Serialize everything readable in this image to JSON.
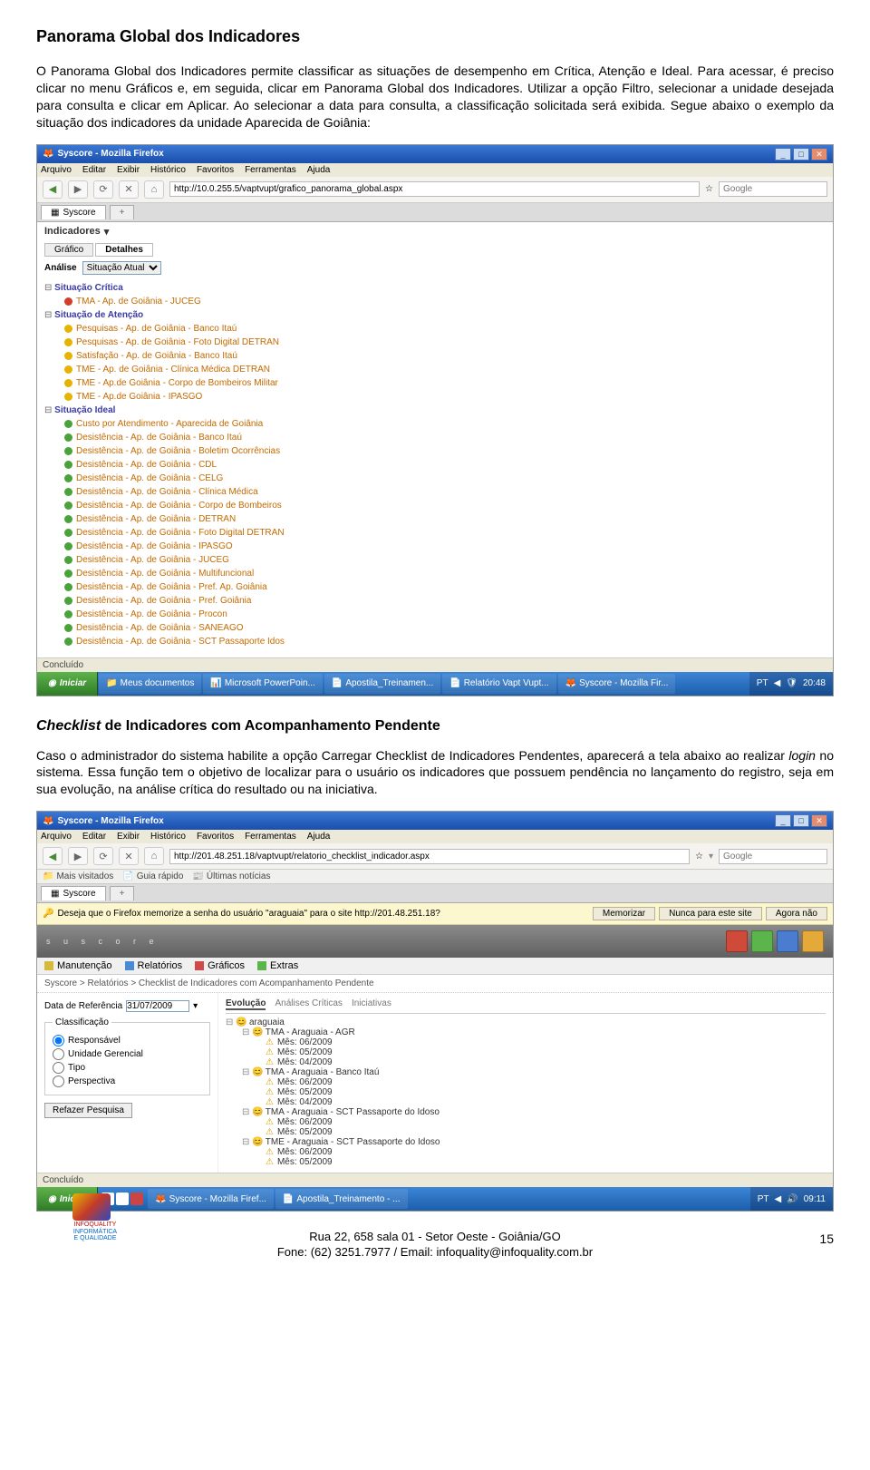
{
  "h1": "Panorama Global dos Indicadores",
  "p1a": "O Panorama Global dos Indicadores permite classificar as situações de desempenho em Crítica, Atenção e Ideal. Para acessar, é preciso clicar no menu Gráficos e, em seguida, clicar em Panorama Global dos Indicadores. Utilizar a opção Filtro, selecionar a unidade desejada para consulta e clicar em Aplicar. Ao selecionar a data para consulta, a classificação solicitada será exibida. Segue abaixo o exemplo da situação dos indicadores da unidade Aparecida de Goiânia:",
  "h2_prefix": "Checklist",
  "h2_rest": " de Indicadores com Acompanhamento Pendente",
  "p2": "Caso o administrador do sistema habilite a opção Carregar Checklist de Indicadores Pendentes, aparecerá a tela abaixo ao realizar ",
  "p2_italic": "login",
  "p2_end": " no sistema. Essa função tem o objetivo de localizar para o usuário os indicadores que possuem pendência no lançamento do registro, seja em sua evolução, na análise crítica do resultado ou na iniciativa.",
  "ss1": {
    "title": "Syscore - Mozilla Firefox",
    "menu": [
      "Arquivo",
      "Editar",
      "Exibir",
      "Histórico",
      "Favoritos",
      "Ferramentas",
      "Ajuda"
    ],
    "url": "http://10.0.255.5/vaptvupt/grafico_panorama_global.aspx",
    "search_ph": "Google",
    "tab": "Syscore",
    "content_title": "Indicadores",
    "subtabs": [
      "Gráfico",
      "Detalhes"
    ],
    "analysis_label": "Análise",
    "analysis_sel": "Situação Atual",
    "groups": [
      {
        "name": "Situação Crítica",
        "color": "red",
        "items": [
          "TMA - Ap. de Goiânia - JUCEG"
        ]
      },
      {
        "name": "Situação de Atenção",
        "color": "yellow",
        "items": [
          "Pesquisas - Ap. de Goiânia - Banco Itaú",
          "Pesquisas - Ap. de Goiânia - Foto Digital DETRAN",
          "Satisfação - Ap. de Goiânia - Banco Itaú",
          "TME - Ap. de Goiânia - Clínica Médica DETRAN",
          "TME - Ap.de Goiânia - Corpo de Bombeiros Militar",
          "TME - Ap.de Goiânia - IPASGO"
        ]
      },
      {
        "name": "Situação Ideal",
        "color": "green",
        "items": [
          "Custo por Atendimento - Aparecida de Goiânia",
          "Desistência - Ap. de Goiânia - Banco Itaú",
          "Desistência - Ap. de Goiânia - Boletim Ocorrências",
          "Desistência - Ap. de Goiânia - CDL",
          "Desistência - Ap. de Goiânia - CELG",
          "Desistência - Ap. de Goiânia - Clínica Médica",
          "Desistência - Ap. de Goiânia - Corpo de Bombeiros",
          "Desistência - Ap. de Goiânia - DETRAN",
          "Desistência - Ap. de Goiânia - Foto Digital DETRAN",
          "Desistência - Ap. de Goiânia - IPASGO",
          "Desistência - Ap. de Goiânia - JUCEG",
          "Desistência - Ap. de Goiânia - Multifuncional",
          "Desistência - Ap. de Goiânia - Pref. Ap. Goiânia",
          "Desistência - Ap. de Goiânia - Pref. Goiânia",
          "Desistência - Ap. de Goiânia - Procon",
          "Desistência - Ap. de Goiânia - SANEAGO",
          "Desistência - Ap. de Goiânia - SCT Passaporte Idos"
        ]
      }
    ],
    "status": "Concluído",
    "task": {
      "start": "Iniciar",
      "items": [
        "Meus documentos",
        "Microsoft PowerPoin...",
        "Apostila_Treinamen...",
        "Relatório Vapt Vupt...",
        "Syscore - Mozilla Fir..."
      ],
      "lang": "PT",
      "time": "20:48"
    }
  },
  "ss2": {
    "title": "Syscore - Mozilla Firefox",
    "menu": [
      "Arquivo",
      "Editar",
      "Exibir",
      "Histórico",
      "Favoritos",
      "Ferramentas",
      "Ajuda"
    ],
    "url": "http://201.48.251.18/vaptvupt/relatorio_checklist_indicador.aspx",
    "search_ph": "Google",
    "bookmarks": [
      "Mais visitados",
      "Guia rápido",
      "Últimas notícias"
    ],
    "tab": "Syscore",
    "infobar_msg": "Deseja que o Firefox memorize a senha do usuário \"araguaia\" para o site http://201.48.251.18?",
    "infobar_btns": [
      "Memorizar",
      "Nunca para este site",
      "Agora não"
    ],
    "app_menu": [
      "Manutenção",
      "Relatórios",
      "Gráficos",
      "Extras"
    ],
    "breadcrumb": "Syscore > Relatórios > Checklist de Indicadores com Acompanhamento Pendente",
    "date_label": "Data de Referência",
    "date_value": "31/07/2009",
    "fieldset_legend": "Classificação",
    "radios": [
      "Responsável",
      "Unidade Gerencial",
      "Tipo",
      "Perspectiva"
    ],
    "refresh_btn": "Refazer Pesquisa",
    "right_tabs": [
      "Evolução",
      "Análises Críticas",
      "Iniciativas"
    ],
    "root": "araguaia",
    "nodes": [
      {
        "name": "TMA - Araguaia - AGR",
        "months": [
          "Mês: 06/2009",
          "Mês: 05/2009",
          "Mês: 04/2009"
        ]
      },
      {
        "name": "TMA - Araguaia - Banco Itaú",
        "months": [
          "Mês: 06/2009",
          "Mês: 05/2009",
          "Mês: 04/2009"
        ]
      },
      {
        "name": "TMA - Araguaia - SCT Passaporte do Idoso",
        "months": [
          "Mês: 06/2009",
          "Mês: 05/2009"
        ]
      },
      {
        "name": "TME - Araguaia - SCT Passaporte do Idoso",
        "months": [
          "Mês: 06/2009",
          "Mês: 05/2009"
        ]
      }
    ],
    "status": "Concluído",
    "task": {
      "start": "Iniciar",
      "items": [
        "Syscore - Mozilla Firef...",
        "Apostila_Treinamento - ..."
      ],
      "lang": "PT",
      "time": "09:11"
    }
  },
  "footer": {
    "line1": "Rua 22, 658 sala 01 - Setor Oeste - Goiânia/GO",
    "line2": "Fone: (62) 3251.7977 / Email: infoquality@infoquality.com.br",
    "logo_name": "INFOQUALITY",
    "logo_sub": "INFORMÁTICA E QUALIDADE",
    "page": "15"
  }
}
